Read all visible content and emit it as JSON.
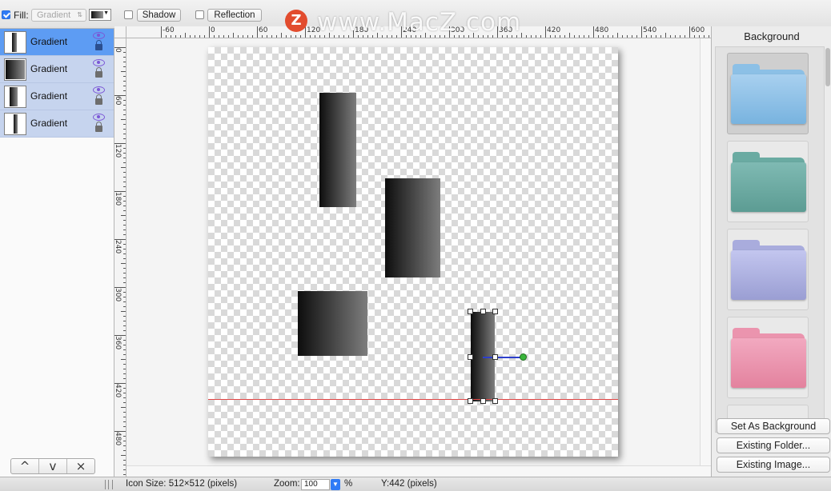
{
  "toolbar": {
    "fill_label": "Fill:",
    "fill_checked": true,
    "fill_type": "Gradient",
    "shadow_label": "Shadow",
    "shadow_checked": false,
    "reflection_label": "Reflection",
    "reflection_checked": false
  },
  "watermark": {
    "logo": "Z",
    "text": "www.MacZ.com"
  },
  "layers": {
    "items": [
      {
        "label": "Gradient",
        "selected": true
      },
      {
        "label": "Gradient",
        "selected": false
      },
      {
        "label": "Gradient",
        "selected": false
      },
      {
        "label": "Gradient",
        "selected": false
      }
    ],
    "buttons": [
      "^",
      "v",
      "×"
    ]
  },
  "rulers": {
    "top_labels": [
      "-60",
      "0",
      "60",
      "120",
      "180",
      "240",
      "300",
      "360",
      "420",
      "480",
      "540",
      "600"
    ],
    "left_labels": [
      "0",
      "60",
      "120",
      "180",
      "240",
      "300",
      "360",
      "420",
      "480"
    ]
  },
  "canvas": {
    "guide_color": "#e04646",
    "gradient_line_color": "#2d3fcc",
    "gradient_end_color": "#39b43b"
  },
  "right_panel": {
    "title": "Background",
    "folders": [
      {
        "name": "blue-folder",
        "colors": [
          "#a8d0ef",
          "#8cc0e6",
          "#78b3df"
        ]
      },
      {
        "name": "teal-folder",
        "colors": [
          "#7fbab3",
          "#6aaba2",
          "#5c9c93"
        ]
      },
      {
        "name": "lavender-folder",
        "colors": [
          "#c3c6ef",
          "#a9acdd",
          "#9a9ed3"
        ]
      },
      {
        "name": "pink-folder",
        "colors": [
          "#f2a9c0",
          "#eb94ae",
          "#e3829e"
        ]
      }
    ],
    "set_background": "Set As Background",
    "existing_folder": "Existing Folder...",
    "existing_image": "Existing Image..."
  },
  "status": {
    "icon_size": "Icon Size: 512×512 (pixels)",
    "zoom_label": "Zoom:",
    "zoom_value": "100",
    "zoom_unit": "%",
    "y_readout": "Y:442 (pixels)"
  }
}
